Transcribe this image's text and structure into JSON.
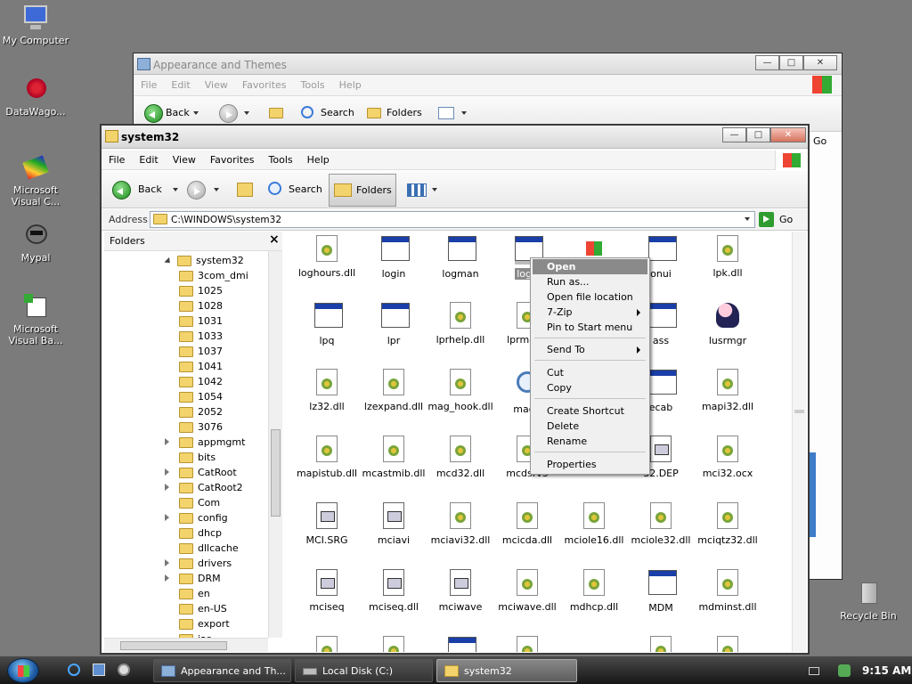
{
  "desktop": {
    "icons": [
      {
        "label": "My Computer",
        "icon": "computer-icon"
      },
      {
        "label": "DataWago...",
        "icon": "splash-icon"
      },
      {
        "label": "Microsoft Visual C...",
        "icon": "visual-c-icon"
      },
      {
        "label": "Mypal",
        "icon": "raccoon-icon"
      },
      {
        "label": "Microsoft Visual Ba...",
        "icon": "visual-basic-icon"
      },
      {
        "label": "Recycle Bin",
        "icon": "recycle-bin-icon"
      }
    ]
  },
  "back_window": {
    "title": "Appearance and Themes",
    "menu": [
      "File",
      "Edit",
      "View",
      "Favorites",
      "Tools",
      "Help"
    ],
    "toolbar": {
      "back": "Back",
      "search": "Search",
      "folders": "Folders",
      "go": "Go"
    }
  },
  "front_window": {
    "title": "system32",
    "menu": [
      "File",
      "Edit",
      "View",
      "Favorites",
      "Tools",
      "Help"
    ],
    "toolbar": {
      "back": "Back",
      "search": "Search",
      "folders": "Folders"
    },
    "address": {
      "label": "Address",
      "value": "C:\\WINDOWS\\system32",
      "go": "Go"
    },
    "folders_pane": {
      "title": "Folders",
      "root": "system32",
      "items": [
        "3com_dmi",
        "1025",
        "1028",
        "1031",
        "1033",
        "1037",
        "1041",
        "1042",
        "1054",
        "2052",
        "3076",
        "appmgmt",
        "bits",
        "CatRoot",
        "CatRoot2",
        "Com",
        "config",
        "dhcp",
        "dllcache",
        "drivers",
        "DRM",
        "en",
        "en-US",
        "export",
        "ias"
      ]
    },
    "files": [
      [
        "loghours.dll",
        "login",
        "logman",
        "logo",
        "",
        "onui",
        "lpk.dll"
      ],
      [
        "lpq",
        "lpr",
        "lprhelp.dll",
        "lprmonu",
        "",
        "ass",
        "lusrmgr"
      ],
      [
        "lz32.dll",
        "lzexpand.dll",
        "mag_hook.dll",
        "magn",
        "",
        "ecab",
        "mapi32.dll"
      ],
      [
        "mapistub.dll",
        "mcastmib.dll",
        "mcd32.dll",
        "mcdsrv3",
        "",
        "32.DEP",
        "mci32.ocx"
      ],
      [
        "MCI.SRG",
        "mciavi",
        "mciavi32.dll",
        "mcicda.dll",
        "mciole16.dll",
        "mciole32.dll",
        "mciqtz32.dll"
      ],
      [
        "mciseq",
        "mciseq.dll",
        "mciwave",
        "mciwave.dll",
        "mdhcp.dll",
        "MDM",
        "mdminst.dll"
      ]
    ]
  },
  "context_menu": {
    "items": [
      "Open",
      "Run as...",
      "Open file location",
      "7-Zip",
      "Pin to Start menu",
      "Send To",
      "Cut",
      "Copy",
      "Create Shortcut",
      "Delete",
      "Rename",
      "Properties"
    ]
  },
  "taskbar": {
    "buttons": [
      "Appearance and Th...",
      "Local Disk (C:)",
      "system32"
    ],
    "clock": "9:15 AM"
  },
  "colors": {
    "selection": "#8a8a8a",
    "titlebar": "#e4e4e4",
    "taskbar": "#262626"
  }
}
